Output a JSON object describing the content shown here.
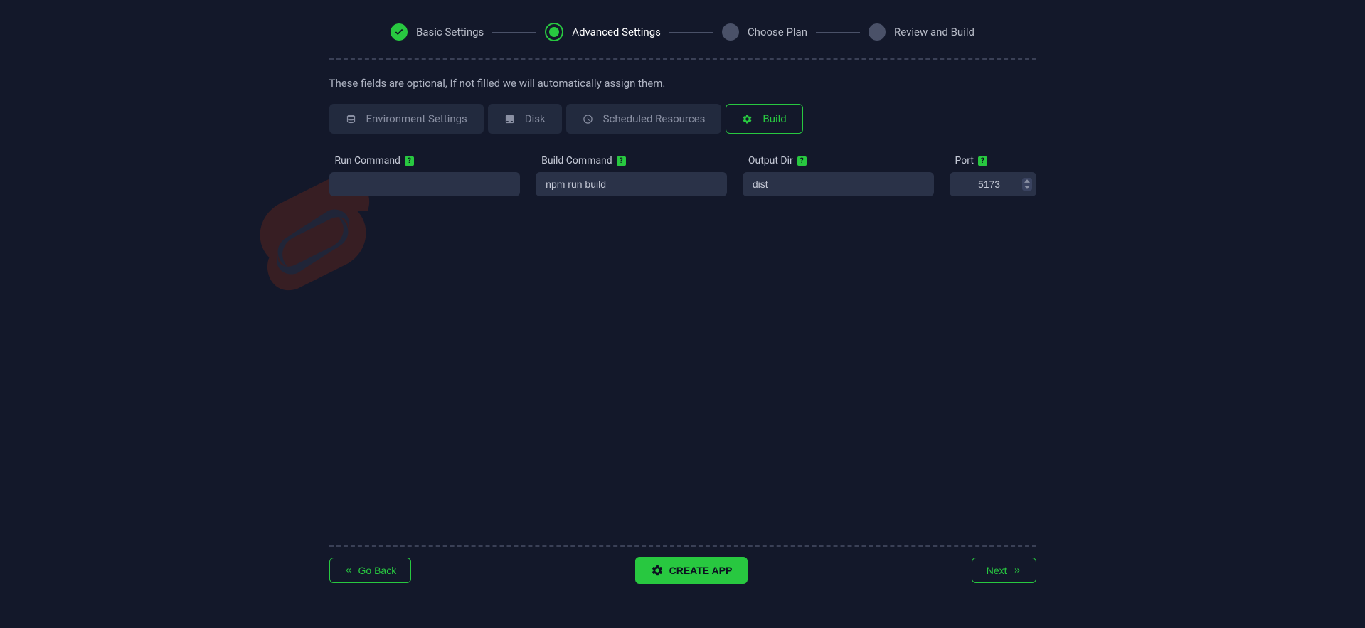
{
  "stepper": {
    "steps": [
      {
        "label": "Basic Settings",
        "status": "completed"
      },
      {
        "label": "Advanced Settings",
        "status": "active"
      },
      {
        "label": "Choose Plan",
        "status": "pending"
      },
      {
        "label": "Review and Build",
        "status": "pending"
      }
    ]
  },
  "info_text": "These fields are optional, If not filled we will automatically assign them.",
  "tabs": [
    {
      "label": "Environment Settings",
      "icon": "database-icon",
      "active": false
    },
    {
      "label": "Disk",
      "icon": "inbox-icon",
      "active": false
    },
    {
      "label": "Scheduled Resources",
      "icon": "clock-icon",
      "active": false
    },
    {
      "label": "Build",
      "icon": "gear-icon",
      "active": true
    }
  ],
  "fields": {
    "run_command": {
      "label": "Run Command",
      "value": ""
    },
    "build_command": {
      "label": "Build Command",
      "value": "npm run build"
    },
    "output_dir": {
      "label": "Output Dir",
      "value": "dist"
    },
    "port": {
      "label": "Port",
      "value": "5173"
    }
  },
  "buttons": {
    "back": "Go Back",
    "create": "CREATE APP",
    "next": "Next"
  },
  "colors": {
    "accent": "#28c840",
    "bg": "#13182a",
    "input_bg": "#2a3248",
    "tab_bg": "#222a3e"
  }
}
